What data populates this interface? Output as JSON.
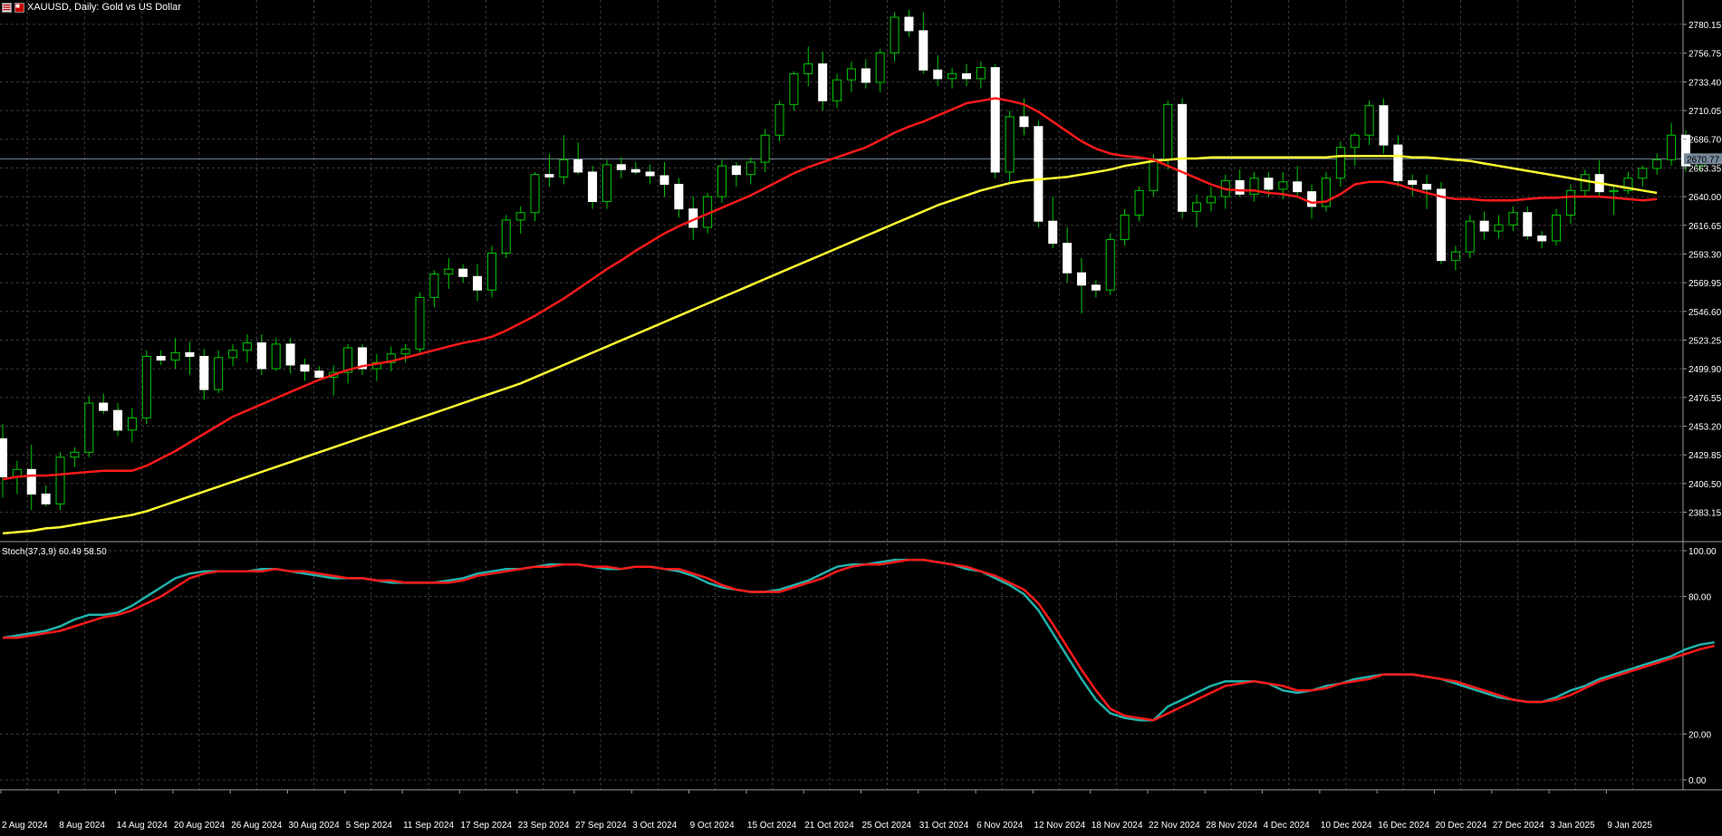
{
  "header": {
    "symbol_label": "XAUUSD, Daily:  Gold vs US Dollar"
  },
  "colors": {
    "background": "#000000",
    "grid": "#3c3c3c",
    "candle_up": "#000000",
    "candle_up_border": "#00c800",
    "candle_down": "#ffffff",
    "ma_fast": "#ff1a1a",
    "ma_slow": "#ffff33",
    "stoch_main": "#20b2aa",
    "stoch_signal": "#ff1a1a",
    "price_line": "#778899",
    "axis_text": "#ffffff"
  },
  "chart_data": [
    {
      "type": "candlestick",
      "title": "XAUUSD, Daily:  Gold vs US Dollar",
      "ylim": [
        2360,
        2800
      ],
      "y_ticks": [
        "2780.15",
        "2756.75",
        "2733.40",
        "2710.05",
        "2686.70",
        "2663.35",
        "2640.00",
        "2616.65",
        "2593.30",
        "2569.95",
        "2546.60",
        "2523.25",
        "2499.90",
        "2476.55",
        "2453.20",
        "2429.85",
        "2406.50",
        "2383.15"
      ],
      "x_labels": [
        "2 Aug 2024",
        "8 Aug 2024",
        "14 Aug 2024",
        "20 Aug 2024",
        "26 Aug 2024",
        "30 Aug 2024",
        "5 Sep 2024",
        "11 Sep 2024",
        "17 Sep 2024",
        "23 Sep 2024",
        "27 Sep 2024",
        "3 Oct 2024",
        "9 Oct 2024",
        "15 Oct 2024",
        "21 Oct 2024",
        "25 Oct 2024",
        "31 Oct 2024",
        "6 Nov 2024",
        "12 Nov 2024",
        "18 Nov 2024",
        "22 Nov 2024",
        "28 Nov 2024",
        "4 Dec 2024",
        "10 Dec 2024",
        "16 Dec 2024",
        "20 Dec 2024",
        "27 Dec 2024",
        "3 Jan 2025",
        "9 Jan 2025"
      ],
      "current_price": "2670.77",
      "candles": [
        [
          2443,
          2455,
          2395,
          2412
        ],
        [
          2412,
          2425,
          2398,
          2418
        ],
        [
          2418,
          2438,
          2385,
          2398
        ],
        [
          2398,
          2405,
          2388,
          2390
        ],
        [
          2390,
          2432,
          2385,
          2428
        ],
        [
          2428,
          2436,
          2420,
          2432
        ],
        [
          2432,
          2478,
          2428,
          2472
        ],
        [
          2472,
          2480,
          2463,
          2466
        ],
        [
          2466,
          2472,
          2445,
          2450
        ],
        [
          2450,
          2468,
          2440,
          2460
        ],
        [
          2460,
          2515,
          2455,
          2510
        ],
        [
          2510,
          2515,
          2503,
          2507
        ],
        [
          2507,
          2525,
          2500,
          2513
        ],
        [
          2513,
          2522,
          2495,
          2510
        ],
        [
          2510,
          2516,
          2475,
          2483
        ],
        [
          2483,
          2515,
          2480,
          2509
        ],
        [
          2509,
          2520,
          2502,
          2515
        ],
        [
          2515,
          2528,
          2505,
          2521
        ],
        [
          2521,
          2528,
          2495,
          2500
        ],
        [
          2500,
          2525,
          2498,
          2520
        ],
        [
          2520,
          2525,
          2496,
          2503
        ],
        [
          2503,
          2508,
          2490,
          2498
        ],
        [
          2498,
          2502,
          2490,
          2493
        ],
        [
          2493,
          2503,
          2478,
          2497
        ],
        [
          2497,
          2520,
          2488,
          2517
        ],
        [
          2517,
          2520,
          2495,
          2500
        ],
        [
          2500,
          2512,
          2490,
          2505
        ],
        [
          2505,
          2518,
          2498,
          2512
        ],
        [
          2512,
          2520,
          2505,
          2516
        ],
        [
          2516,
          2562,
          2513,
          2558
        ],
        [
          2558,
          2580,
          2550,
          2577
        ],
        [
          2577,
          2590,
          2565,
          2581
        ],
        [
          2581,
          2585,
          2570,
          2575
        ],
        [
          2575,
          2585,
          2555,
          2564
        ],
        [
          2564,
          2600,
          2558,
          2594
        ],
        [
          2594,
          2625,
          2590,
          2621
        ],
        [
          2621,
          2632,
          2610,
          2627
        ],
        [
          2627,
          2660,
          2620,
          2658
        ],
        [
          2658,
          2675,
          2648,
          2656
        ],
        [
          2656,
          2690,
          2650,
          2670
        ],
        [
          2670,
          2684,
          2658,
          2660
        ],
        [
          2660,
          2665,
          2630,
          2636
        ],
        [
          2636,
          2670,
          2630,
          2666
        ],
        [
          2666,
          2672,
          2655,
          2662
        ],
        [
          2662,
          2668,
          2658,
          2660
        ],
        [
          2660,
          2666,
          2650,
          2657
        ],
        [
          2657,
          2668,
          2640,
          2650
        ],
        [
          2650,
          2655,
          2623,
          2630
        ],
        [
          2630,
          2640,
          2605,
          2615
        ],
        [
          2615,
          2643,
          2610,
          2640
        ],
        [
          2640,
          2670,
          2635,
          2665
        ],
        [
          2665,
          2668,
          2648,
          2658
        ],
        [
          2658,
          2672,
          2650,
          2668
        ],
        [
          2668,
          2695,
          2660,
          2690
        ],
        [
          2690,
          2718,
          2685,
          2715
        ],
        [
          2715,
          2742,
          2710,
          2740
        ],
        [
          2740,
          2762,
          2730,
          2748
        ],
        [
          2748,
          2758,
          2710,
          2718
        ],
        [
          2718,
          2740,
          2712,
          2735
        ],
        [
          2735,
          2750,
          2725,
          2744
        ],
        [
          2744,
          2752,
          2728,
          2733
        ],
        [
          2733,
          2760,
          2725,
          2757
        ],
        [
          2757,
          2790,
          2750,
          2786
        ],
        [
          2786,
          2792,
          2770,
          2775
        ],
        [
          2775,
          2790,
          2740,
          2743
        ],
        [
          2743,
          2755,
          2730,
          2736
        ],
        [
          2736,
          2745,
          2728,
          2740
        ],
        [
          2740,
          2748,
          2730,
          2736
        ],
        [
          2736,
          2750,
          2728,
          2745
        ],
        [
          2745,
          2748,
          2655,
          2660
        ],
        [
          2660,
          2710,
          2650,
          2705
        ],
        [
          2705,
          2720,
          2690,
          2697
        ],
        [
          2697,
          2702,
          2615,
          2620
        ],
        [
          2620,
          2640,
          2598,
          2602
        ],
        [
          2602,
          2615,
          2570,
          2578
        ],
        [
          2578,
          2590,
          2545,
          2568
        ],
        [
          2568,
          2572,
          2558,
          2564
        ],
        [
          2564,
          2610,
          2560,
          2605
        ],
        [
          2605,
          2630,
          2600,
          2625
        ],
        [
          2625,
          2648,
          2620,
          2645
        ],
        [
          2645,
          2675,
          2640,
          2670
        ],
        [
          2670,
          2718,
          2662,
          2715
        ],
        [
          2715,
          2720,
          2622,
          2628
        ],
        [
          2628,
          2642,
          2615,
          2635
        ],
        [
          2635,
          2648,
          2628,
          2640
        ],
        [
          2640,
          2658,
          2630,
          2653
        ],
        [
          2653,
          2662,
          2640,
          2642
        ],
        [
          2642,
          2660,
          2636,
          2655
        ],
        [
          2655,
          2660,
          2640,
          2646
        ],
        [
          2646,
          2660,
          2638,
          2652
        ],
        [
          2652,
          2665,
          2640,
          2644
        ],
        [
          2644,
          2650,
          2622,
          2632
        ],
        [
          2632,
          2660,
          2628,
          2655
        ],
        [
          2655,
          2685,
          2648,
          2680
        ],
        [
          2680,
          2692,
          2665,
          2690
        ],
        [
          2690,
          2718,
          2682,
          2714
        ],
        [
          2714,
          2720,
          2675,
          2682
        ],
        [
          2682,
          2690,
          2648,
          2653
        ],
        [
          2653,
          2658,
          2640,
          2650
        ],
        [
          2650,
          2658,
          2630,
          2646
        ],
        [
          2646,
          2652,
          2585,
          2588
        ],
        [
          2588,
          2600,
          2580,
          2595
        ],
        [
          2595,
          2625,
          2590,
          2620
        ],
        [
          2620,
          2628,
          2605,
          2612
        ],
        [
          2612,
          2625,
          2606,
          2617
        ],
        [
          2617,
          2632,
          2612,
          2627
        ],
        [
          2627,
          2632,
          2605,
          2608
        ],
        [
          2608,
          2612,
          2598,
          2604
        ],
        [
          2604,
          2630,
          2600,
          2625
        ],
        [
          2625,
          2650,
          2618,
          2645
        ],
        [
          2645,
          2662,
          2640,
          2658
        ],
        [
          2658,
          2670,
          2640,
          2644
        ],
        [
          2644,
          2650,
          2625,
          2645
        ],
        [
          2645,
          2660,
          2642,
          2655
        ],
        [
          2655,
          2665,
          2648,
          2663
        ],
        [
          2663,
          2675,
          2658,
          2670
        ],
        [
          2670,
          2700,
          2665,
          2690
        ],
        [
          2690,
          2694,
          2660,
          2665
        ],
        [
          2665,
          2672,
          2660,
          2670
        ]
      ],
      "ma_fast": [
        2410,
        2412,
        2413,
        2413,
        2414,
        2415,
        2416,
        2417,
        2417,
        2417,
        2421,
        2427,
        2433,
        2440,
        2447,
        2454,
        2461,
        2466,
        2471,
        2476,
        2481,
        2486,
        2491,
        2495,
        2499,
        2502,
        2504,
        2506,
        2509,
        2512,
        2515,
        2518,
        2521,
        2523,
        2526,
        2531,
        2537,
        2543,
        2550,
        2557,
        2565,
        2573,
        2581,
        2588,
        2596,
        2603,
        2610,
        2616,
        2621,
        2626,
        2631,
        2636,
        2641,
        2647,
        2653,
        2659,
        2664,
        2668,
        2672,
        2676,
        2680,
        2686,
        2692,
        2697,
        2701,
        2706,
        2711,
        2716,
        2718,
        2720,
        2718,
        2715,
        2709,
        2701,
        2693,
        2685,
        2679,
        2675,
        2673,
        2672,
        2670,
        2665,
        2660,
        2655,
        2650,
        2646,
        2645,
        2645,
        2643,
        2642,
        2640,
        2635,
        2636,
        2642,
        2650,
        2652,
        2652,
        2650,
        2646,
        2643,
        2640,
        2638,
        2638,
        2637,
        2637,
        2637,
        2638,
        2639,
        2639,
        2640,
        2640,
        2640,
        2639,
        2638,
        2637,
        2638
      ],
      "ma_slow": [
        2366,
        2367,
        2368,
        2370,
        2371,
        2373,
        2375,
        2377,
        2379,
        2381,
        2384,
        2388,
        2392,
        2396,
        2400,
        2404,
        2408,
        2412,
        2416,
        2420,
        2424,
        2428,
        2432,
        2436,
        2440,
        2444,
        2448,
        2452,
        2456,
        2460,
        2464,
        2468,
        2472,
        2476,
        2480,
        2484,
        2488,
        2493,
        2498,
        2503,
        2508,
        2513,
        2518,
        2523,
        2528,
        2533,
        2538,
        2543,
        2548,
        2553,
        2558,
        2563,
        2568,
        2573,
        2578,
        2583,
        2588,
        2593,
        2598,
        2603,
        2608,
        2613,
        2618,
        2623,
        2628,
        2633,
        2637,
        2641,
        2645,
        2648,
        2651,
        2653,
        2654,
        2655,
        2656,
        2658,
        2660,
        2662,
        2665,
        2667,
        2669,
        2670,
        2671,
        2671,
        2672,
        2672,
        2672,
        2672,
        2672,
        2672,
        2672,
        2672,
        2672,
        2673,
        2673,
        2673,
        2673,
        2673,
        2672,
        2672,
        2671,
        2670,
        2669,
        2667,
        2665,
        2663,
        2661,
        2659,
        2657,
        2655,
        2653,
        2651,
        2649,
        2647,
        2645,
        2643
      ]
    },
    {
      "type": "line",
      "title": "Stoch(37,3,9) 60.49 58.50",
      "ylim": [
        0,
        100
      ],
      "y_ticks": [
        "100.00",
        "80.00",
        "20.00",
        "0.00"
      ],
      "series": [
        {
          "values": [
            62,
            63,
            64,
            65,
            67,
            70,
            72,
            72,
            73,
            76,
            80,
            84,
            88,
            90,
            91,
            91,
            91,
            91,
            92,
            92,
            91,
            90,
            89,
            88,
            88,
            88,
            87,
            86,
            86,
            86,
            86,
            87,
            88,
            90,
            91,
            92,
            92,
            93,
            94,
            94,
            94,
            93,
            92,
            92,
            93,
            93,
            92,
            91,
            89,
            86,
            84,
            83,
            82,
            82,
            83,
            85,
            87,
            90,
            93,
            94,
            94,
            95,
            96,
            96,
            96,
            95,
            94,
            92,
            91,
            88,
            85,
            81,
            74,
            64,
            54,
            44,
            35,
            29,
            27,
            26,
            26,
            32,
            35,
            38,
            41,
            43,
            43,
            43,
            42,
            39,
            38,
            39,
            41,
            42,
            44,
            45,
            46,
            46,
            46,
            45,
            44,
            42,
            40,
            38,
            36,
            35,
            34,
            34,
            36,
            39,
            41,
            44,
            46,
            48,
            50,
            52,
            54,
            57,
            59,
            60
          ]
        },
        {
          "values": [
            62,
            62,
            63,
            64,
            65,
            67,
            69,
            71,
            72,
            74,
            77,
            80,
            84,
            88,
            90,
            91,
            91,
            91,
            91,
            92,
            91,
            91,
            90,
            89,
            88,
            88,
            87,
            87,
            86,
            86,
            86,
            86,
            87,
            89,
            90,
            91,
            92,
            93,
            93,
            94,
            94,
            93,
            93,
            92,
            93,
            93,
            92,
            92,
            90,
            88,
            85,
            83,
            82,
            82,
            82,
            84,
            86,
            88,
            91,
            93,
            94,
            94,
            95,
            96,
            96,
            95,
            94,
            93,
            91,
            89,
            86,
            83,
            77,
            68,
            58,
            48,
            39,
            31,
            28,
            27,
            26,
            29,
            32,
            35,
            38,
            41,
            42,
            43,
            42,
            41,
            39,
            39,
            40,
            42,
            43,
            44,
            46,
            46,
            46,
            45,
            44,
            43,
            41,
            39,
            37,
            35,
            34,
            34,
            35,
            37,
            40,
            43,
            45,
            47,
            49,
            51,
            53,
            55,
            57,
            58.5
          ]
        }
      ]
    }
  ]
}
